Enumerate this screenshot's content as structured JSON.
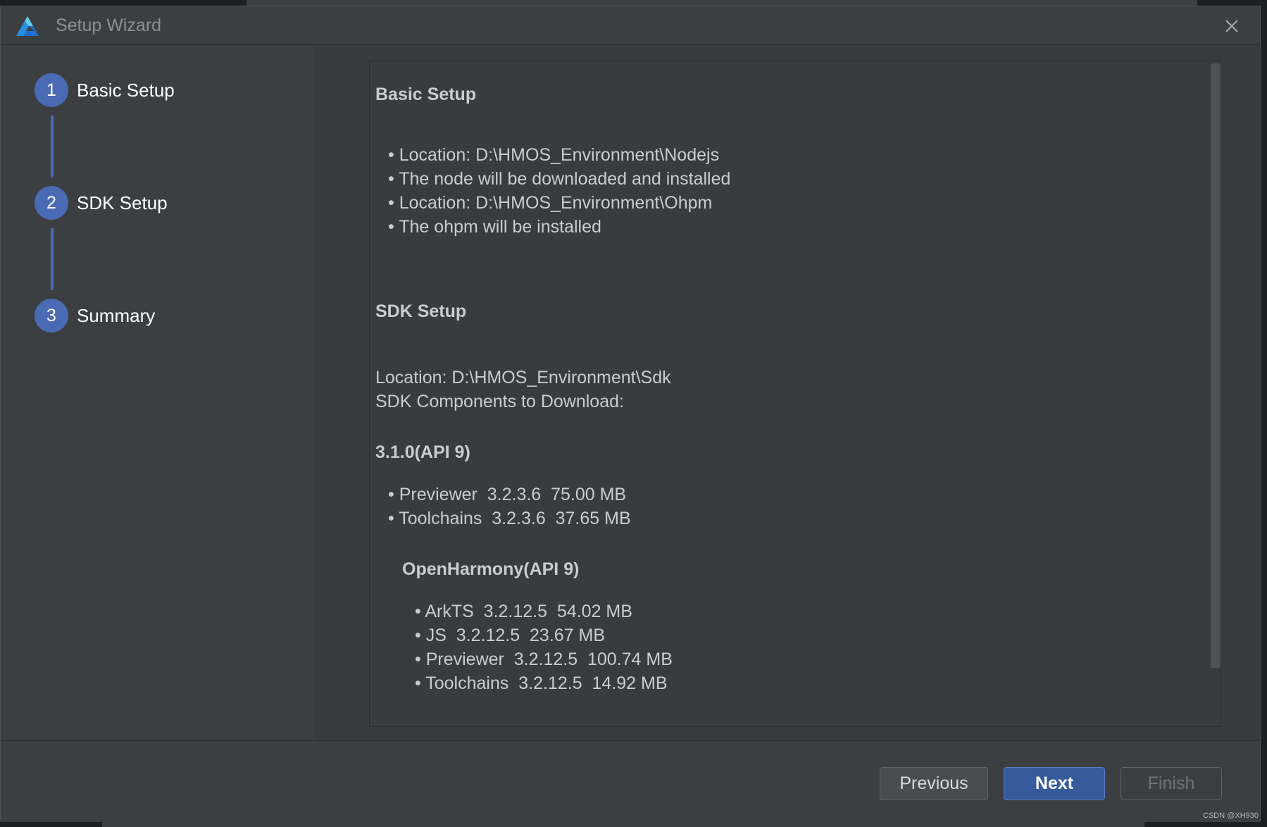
{
  "window": {
    "title": "Setup Wizard",
    "close_icon": "close-icon",
    "logo_icon": "app-logo-icon"
  },
  "steps": [
    {
      "number": "1",
      "label": "Basic Setup"
    },
    {
      "number": "2",
      "label": "SDK Setup"
    },
    {
      "number": "3",
      "label": "Summary"
    }
  ],
  "summary": {
    "basic_heading": "Basic Setup",
    "basic_items": [
      "Location: D:\\HMOS_Environment\\Nodejs",
      "The node will be downloaded and installed",
      "Location: D:\\HMOS_Environment\\Ohpm",
      "The ohpm will be installed"
    ],
    "sdk_heading": "SDK Setup",
    "sdk_location": "Location: D:\\HMOS_Environment\\Sdk",
    "sdk_components_label": "SDK Components to Download:",
    "api_heading": "3.1.0(API 9)",
    "api_items": [
      "Previewer  3.2.3.6  75.00 MB",
      "Toolchains  3.2.3.6  37.65 MB"
    ],
    "oh_heading": "OpenHarmony(API 9)",
    "oh_items": [
      "ArkTS  3.2.12.5  54.02 MB",
      "JS  3.2.12.5  23.67 MB",
      "Previewer  3.2.12.5  100.74 MB",
      "Toolchains  3.2.12.5  14.92 MB"
    ]
  },
  "buttons": {
    "previous": "Previous",
    "next": "Next",
    "finish": "Finish"
  },
  "watermark": "CSDN @XH930",
  "colors": {
    "accent": "#4a6ab3",
    "primary_button": "#365b9c",
    "background": "#3c3f41"
  }
}
